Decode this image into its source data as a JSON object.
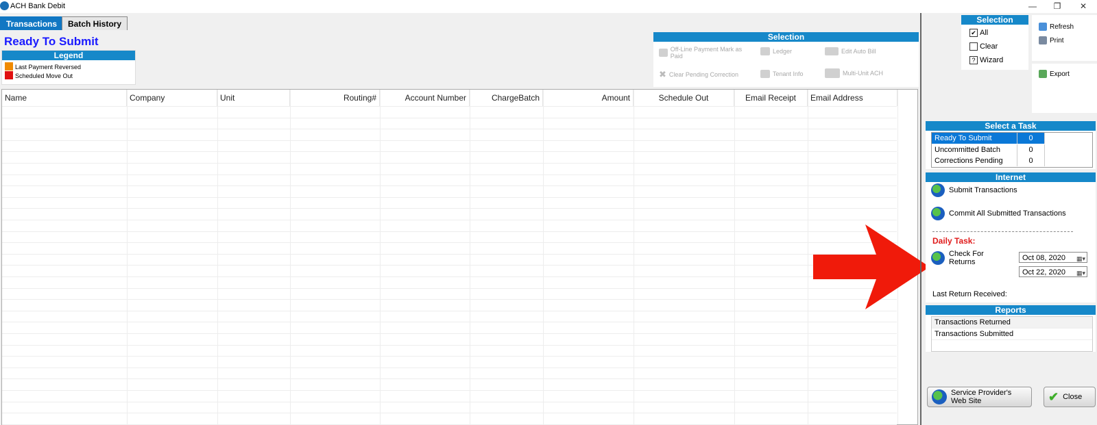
{
  "window": {
    "title": "ACH Bank Debit",
    "controls": [
      "—",
      "❐",
      "✕"
    ]
  },
  "tabs": [
    "Transactions",
    "Batch History"
  ],
  "page_title": "Ready To Submit",
  "legend": {
    "title": "Legend",
    "items": [
      {
        "label": "Last Payment Reversed",
        "color": "#f08a00"
      },
      {
        "label": "Scheduled Move Out",
        "color": "#e01010"
      }
    ]
  },
  "selection_panel": {
    "title": "Selection",
    "items": [
      "Off-Line Payment Mark as Paid",
      "Ledger",
      "Edit Auto Bill",
      "Clear Pending Correction",
      "Tenant Info",
      "Multi-Unit ACH"
    ]
  },
  "grid": {
    "columns": [
      "Name",
      "Company",
      "Unit",
      "Routing#",
      "Account Number",
      "ChargeBatch",
      "Amount",
      "Schedule Out",
      "Email Receipt",
      "Email Address"
    ],
    "rows": []
  },
  "right_selection": {
    "title": "Selection",
    "items": [
      {
        "label": "All",
        "mark": "✔"
      },
      {
        "label": "Clear",
        "mark": ""
      },
      {
        "label": "Wizard",
        "mark": "?"
      }
    ]
  },
  "toolbar": {
    "refresh": "Refresh",
    "print": "Print",
    "export": "Export"
  },
  "tasks": {
    "title": "Select a Task",
    "items": [
      {
        "label": "Ready To Submit",
        "count": "0",
        "selected": true
      },
      {
        "label": "Uncommitted Batch",
        "count": "0",
        "selected": false
      },
      {
        "label": "Corrections Pending",
        "count": "0",
        "selected": false
      }
    ]
  },
  "internet": {
    "title": "Internet",
    "submit": "Submit Transactions",
    "commit": "Commit All Submitted Transactions",
    "daily_task": "Daily Task:",
    "check_returns": "Check For Returns",
    "date_from": "Oct 08, 2020",
    "date_to": "Oct 22, 2020",
    "last_return": "Last Return Received:"
  },
  "reports": {
    "title": "Reports",
    "items": [
      "Transactions Returned",
      "Transactions Submitted"
    ]
  },
  "buttons": {
    "service_provider": "Service Provider's Web Site",
    "close": "Close"
  },
  "colors": {
    "accent_blue": "#1688c9",
    "title_blue": "#1a1aff",
    "annotation_arrow": "#f01a0a"
  }
}
